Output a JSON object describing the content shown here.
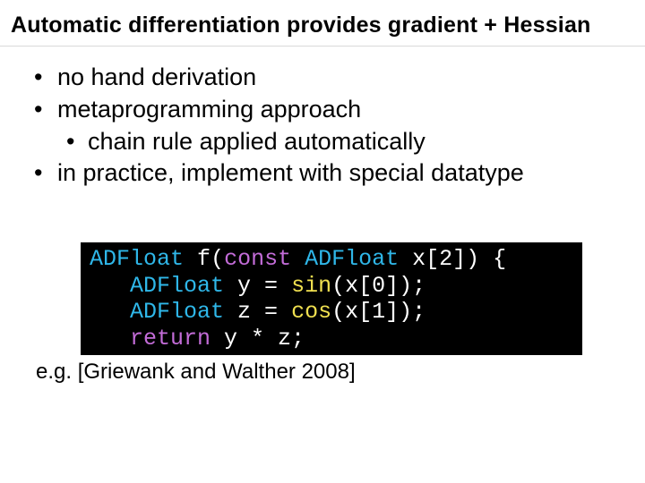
{
  "title": "Automatic differentiation provides gradient + Hessian",
  "bullets": {
    "b1": "no hand derivation",
    "b2": "metaprogramming approach",
    "b2a": "chain rule applied automatically",
    "b3": "in practice, implement with special datatype"
  },
  "code": {
    "l1_type1": "ADFloat",
    "l1_fn": "f",
    "l1_paren_open": "(",
    "l1_kw": "const",
    "l1_type2": "ADFloat",
    "l1_rest": " x[2]) {",
    "l2_indent": "   ",
    "l2_type": "ADFloat",
    "l2_mid": " y = ",
    "l2_call": "sin",
    "l2_rest": "(x[0]);",
    "l3_indent": "   ",
    "l3_type": "ADFloat",
    "l3_mid": " z = ",
    "l3_call": "cos",
    "l3_rest": "(x[1]);",
    "l4_indent": "   ",
    "l4_kw": "return",
    "l4_rest": " y * z;"
  },
  "citation": "e.g. [Griewank and Walther 2008]"
}
